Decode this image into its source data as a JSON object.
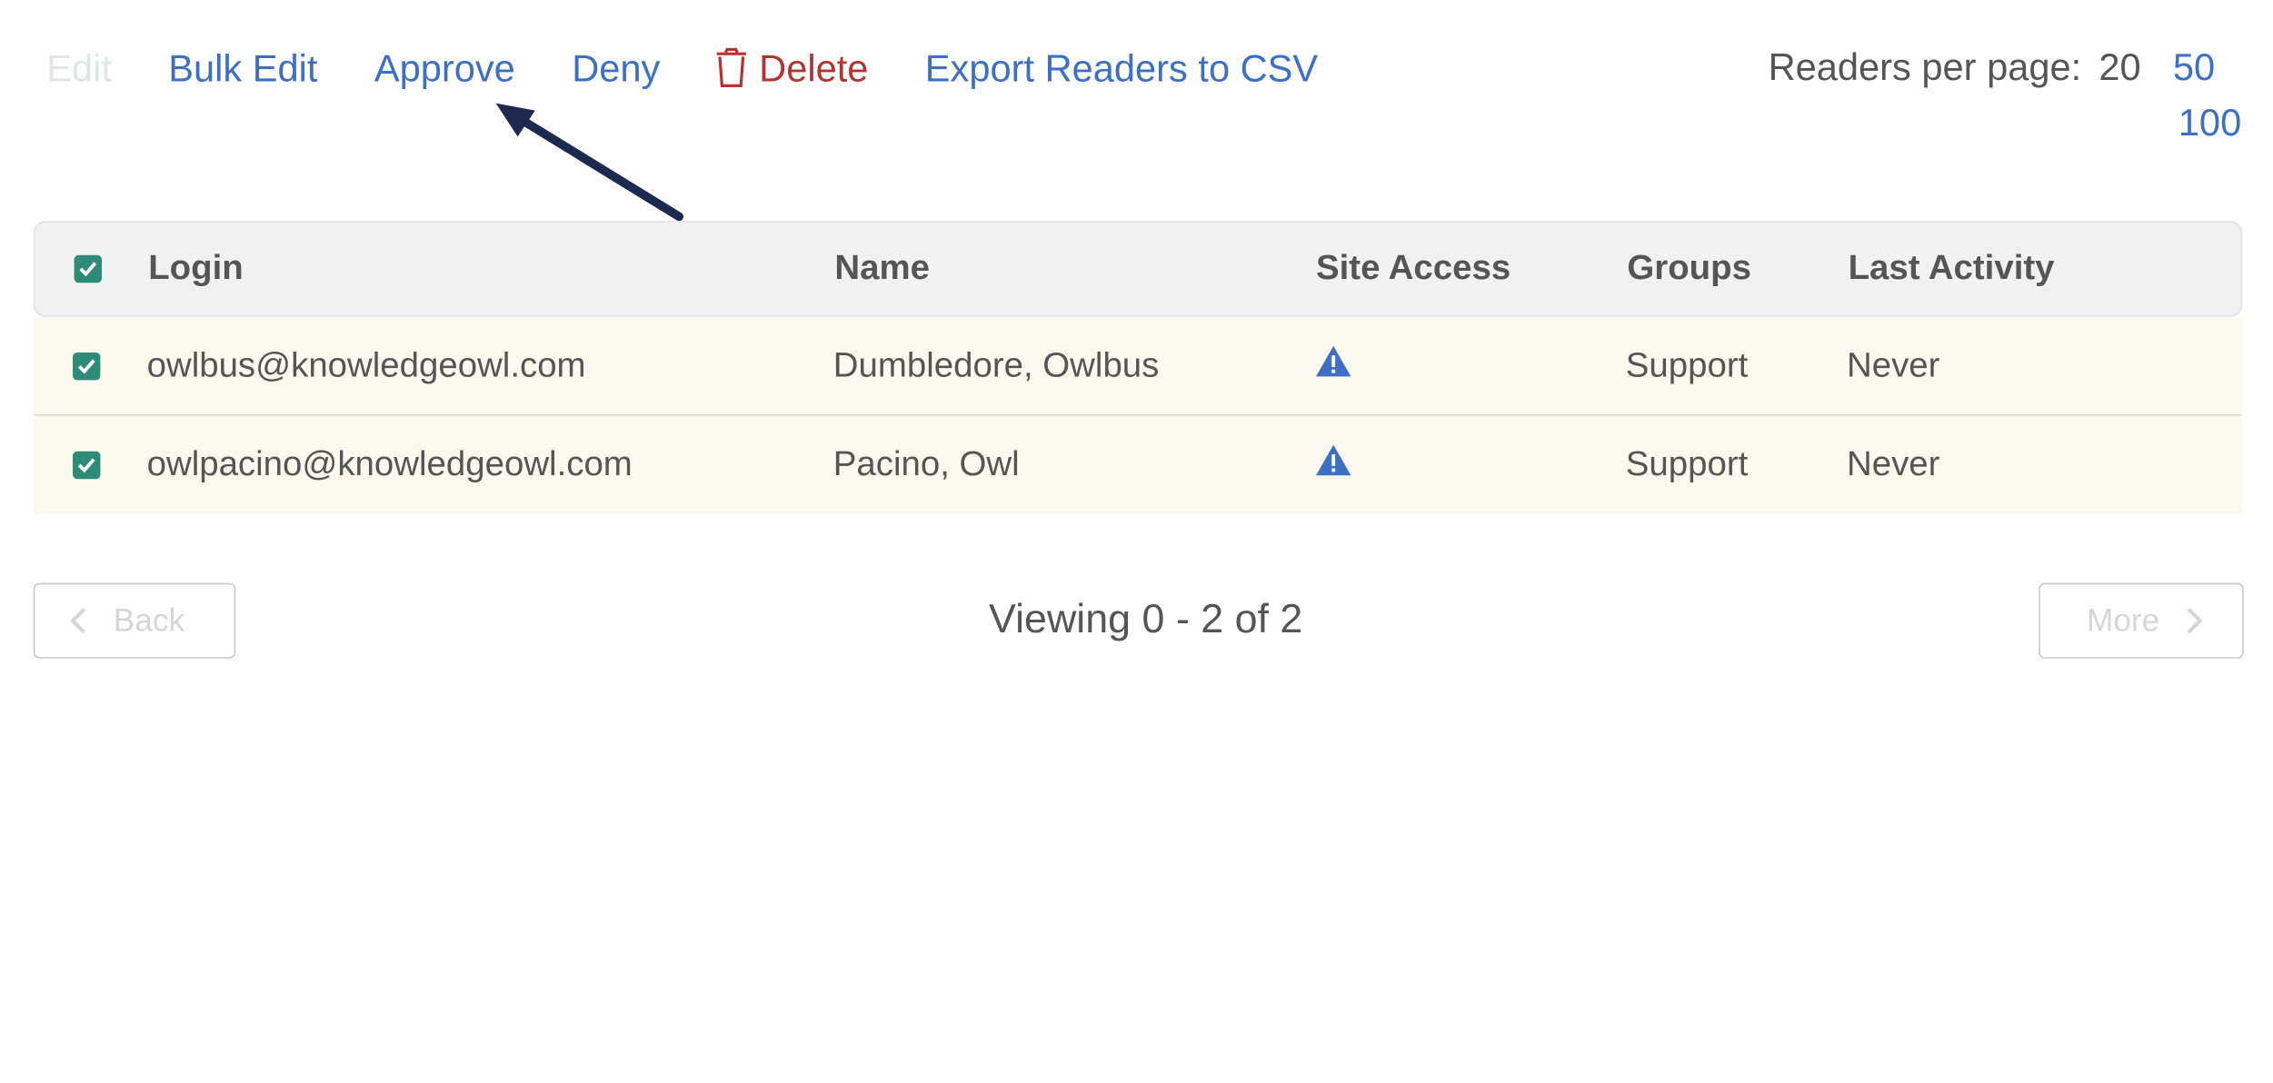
{
  "toolbar": {
    "edit": "Edit",
    "bulk_edit": "Bulk Edit",
    "approve": "Approve",
    "deny": "Deny",
    "delete": "Delete",
    "export": "Export Readers to CSV"
  },
  "per_page": {
    "label": "Readers per page:",
    "options": [
      "20",
      "50",
      "100"
    ],
    "selected": "20"
  },
  "table": {
    "headers": {
      "login": "Login",
      "name": "Name",
      "site_access": "Site Access",
      "groups": "Groups",
      "last_activity": "Last Activity"
    },
    "rows": [
      {
        "login": "owlbus@knowledgeowl.com",
        "name": "Dumbledore, Owlbus",
        "site_access_icon": "warning-icon",
        "groups": "Support",
        "last_activity": "Never",
        "checked": true
      },
      {
        "login": "owlpacino@knowledgeowl.com",
        "name": "Pacino, Owl",
        "site_access_icon": "warning-icon",
        "groups": "Support",
        "last_activity": "Never",
        "checked": true
      }
    ]
  },
  "pagination": {
    "back": "Back",
    "more": "More",
    "viewing": "Viewing 0 - 2 of 2"
  },
  "colors": {
    "link": "#3c6fc6",
    "delete": "#b43434",
    "checkbox": "#2e8b78",
    "row_bg": "#fbf9ee",
    "annotation_arrow": "#1b2a4e"
  }
}
